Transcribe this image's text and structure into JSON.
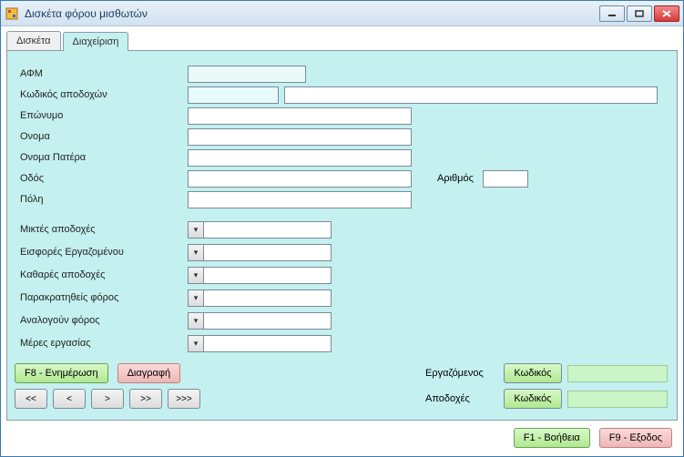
{
  "window": {
    "title": "Δισκέτα φόρου μισθωτών"
  },
  "tabs": [
    {
      "label": "Δισκέτα",
      "active": false
    },
    {
      "label": "Διαχείριση",
      "active": true
    }
  ],
  "fields": {
    "afm": {
      "label": "ΑΦΜ",
      "value": ""
    },
    "pay_code_label": "Κωδικός αποδοχών",
    "pay_code": {
      "value": ""
    },
    "pay_code_desc": {
      "value": ""
    },
    "surname": {
      "label": "Επώνυμο",
      "value": ""
    },
    "name": {
      "label": "Ονομα",
      "value": ""
    },
    "father_name": {
      "label": "Ονομα Πατέρα",
      "value": ""
    },
    "street": {
      "label": "Οδός",
      "value": ""
    },
    "number": {
      "label": "Αριθμός",
      "value": ""
    },
    "city": {
      "label": "Πόλη",
      "value": ""
    }
  },
  "numeric_rows": [
    {
      "key": "gross",
      "label": "Μικτές αποδοχές",
      "value": ""
    },
    {
      "key": "empl_contrib",
      "label": "Εισφορές Εργαζομένου",
      "value": ""
    },
    {
      "key": "net",
      "label": "Καθαρές αποδοχές",
      "value": ""
    },
    {
      "key": "withheld_tax",
      "label": "Παρακρατηθείς φόρος",
      "value": ""
    },
    {
      "key": "calc_tax",
      "label": "Αναλογούν φόρος",
      "value": ""
    },
    {
      "key": "work_days",
      "label": "Μέρες εργασίας",
      "value": ""
    }
  ],
  "buttons": {
    "update": "F8 - Ενημέρωση",
    "delete": "Διαγραφή",
    "help": "F1 - Βοήθεια",
    "exit": "F9 - Εξοδος",
    "code": "Κωδικός"
  },
  "nav": [
    "<<",
    "<",
    ">",
    ">>",
    ">>>"
  ],
  "lookup": {
    "employee_label": "Εργαζόμενος",
    "employee_value": "",
    "pay_label": "Αποδοχές",
    "pay_value": ""
  }
}
